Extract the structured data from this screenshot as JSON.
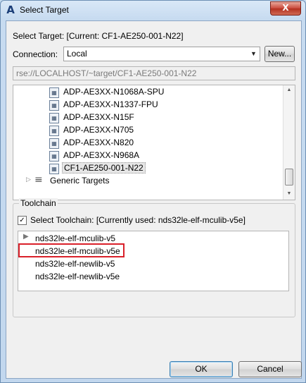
{
  "window": {
    "title": "Select Target",
    "app_icon": "A",
    "close_label": "X"
  },
  "select_target_label": "Select Target: [Current: CF1-AE250-001-N22]",
  "connection": {
    "label": "Connection:",
    "value": "Local",
    "new_button": "New..."
  },
  "uri": "rse://LOCALHOST/~target/CF1-AE250-001-N22",
  "tree": {
    "items": [
      {
        "label": "ADP-AE3XX-N1068A-SPU",
        "icon": "target-chip-icon"
      },
      {
        "label": "ADP-AE3XX-N1337-FPU",
        "icon": "target-chip-icon"
      },
      {
        "label": "ADP-AE3XX-N15F",
        "icon": "target-chip-icon"
      },
      {
        "label": "ADP-AE3XX-N705",
        "icon": "target-chip-icon"
      },
      {
        "label": "ADP-AE3XX-N820",
        "icon": "target-chip-icon"
      },
      {
        "label": "ADP-AE3XX-N968A",
        "icon": "target-chip-icon"
      },
      {
        "label": "CF1-AE250-001-N22",
        "icon": "target-chip-icon",
        "selected": true
      }
    ],
    "group": {
      "label": "Generic Targets",
      "icon": "generic-targets-icon"
    }
  },
  "toolchain": {
    "group_label": "Toolchain",
    "checkbox_label": "Select Toolchain: [Currently used: nds32le-elf-mculib-v5e]",
    "checked": true,
    "items": [
      {
        "label": "nds32le-elf-mculib-v5",
        "has_pointer": true
      },
      {
        "label": "nds32le-elf-mculib-v5e",
        "highlighted": true
      },
      {
        "label": "nds32le-elf-newlib-v5"
      },
      {
        "label": "nds32le-elf-newlib-v5e"
      }
    ]
  },
  "buttons": {
    "ok": "OK",
    "cancel": "Cancel"
  },
  "colors": {
    "highlight_border": "#d9202a",
    "title_bar": "#c7dbf0",
    "close_button": "#c9483a"
  }
}
